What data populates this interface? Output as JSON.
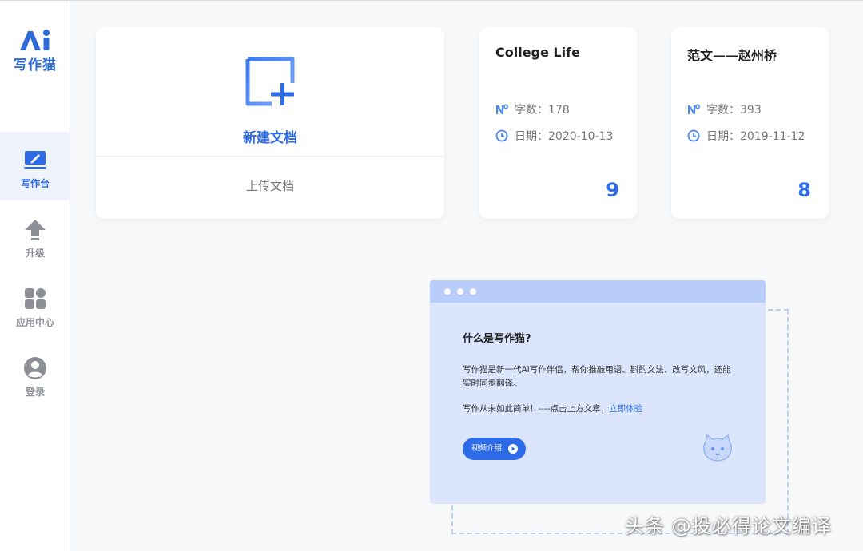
{
  "app": {
    "logo_text": "写作猫"
  },
  "sidebar": {
    "items": [
      {
        "label": "写作台",
        "icon": "pen-board-icon",
        "active": true
      },
      {
        "label": "升级",
        "icon": "upload-arrow-icon",
        "active": false
      },
      {
        "label": "应用中心",
        "icon": "apps-grid-icon",
        "active": false
      },
      {
        "label": "登录",
        "icon": "user-avatar-icon",
        "active": false
      }
    ]
  },
  "new_doc": {
    "label": "新建文档",
    "upload_label": "上传文档",
    "icon": "new-document-plus-icon"
  },
  "documents": [
    {
      "title": "College Life",
      "word_count": "字数：178",
      "date": "日期：2020-10-13",
      "count": "9"
    },
    {
      "title": "范文——赵州桥",
      "word_count": "字数：393",
      "date": "日期：2019-11-12",
      "count": "8"
    }
  ],
  "intro": {
    "heading": "什么是写作猫?",
    "description": "写作猫是新一代AI写作伴侣，帮你推敲用语、斟酌文法、改写文风，还能实时同步翻译。",
    "tip_text": "写作从未如此简单！----点击上方文章，",
    "tip_link": "立即体验",
    "video_button": "视频介绍"
  },
  "watermark": "头条 @投必得论文编译",
  "colors": {
    "accent": "#2e6be6",
    "sidebar_active_bg": "#eef3fc",
    "intro_bg": "#dbe6fd",
    "intro_bar": "#b8cdfa"
  }
}
